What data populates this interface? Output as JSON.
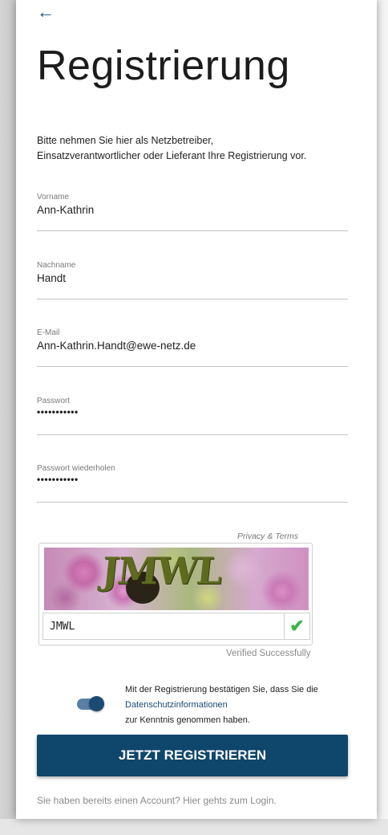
{
  "colors": {
    "primary": "#0f466c",
    "toggle_track": "#5a7fa6",
    "check_green": "#3bb54a"
  },
  "header": {
    "back_icon": "arrow-left-icon",
    "back_glyph": "←",
    "title": "Registrierung"
  },
  "intro": {
    "line1": "Bitte nehmen Sie hier als Netzbetreiber,",
    "line2": "Einsatzverantwortlicher oder Lieferant Ihre Registrierung vor."
  },
  "form": {
    "first_name": {
      "label": "Vorname",
      "value": "Ann-Kathrin"
    },
    "last_name": {
      "label": "Nachname",
      "value": "Handt"
    },
    "email": {
      "label": "E-Mail",
      "value": "Ann-Kathrin.Handt@ewe-netz.de"
    },
    "password": {
      "label": "Passwort",
      "value": "•••••••••••"
    },
    "password_repeat": {
      "label": "Passwort wiederholen",
      "value": "•••••••••••"
    }
  },
  "captcha": {
    "privacy_terms": "Privacy & Terms",
    "image_text": "JMWL",
    "input_value": "JMWL",
    "check_icon": "checkmark-icon",
    "check_glyph": "✔",
    "status": "Verified Successfully"
  },
  "consent": {
    "toggle_on": true,
    "line1": "Mit der Registrierung bestätigen Sie, dass Sie die",
    "link": "Datenschutzinformationen",
    "line3": "zur Kenntnis genommen haben."
  },
  "actions": {
    "submit_label": "JETZT REGISTRIEREN",
    "login_prompt": "Sie haben bereits einen Account? Hier gehts zum Login."
  }
}
